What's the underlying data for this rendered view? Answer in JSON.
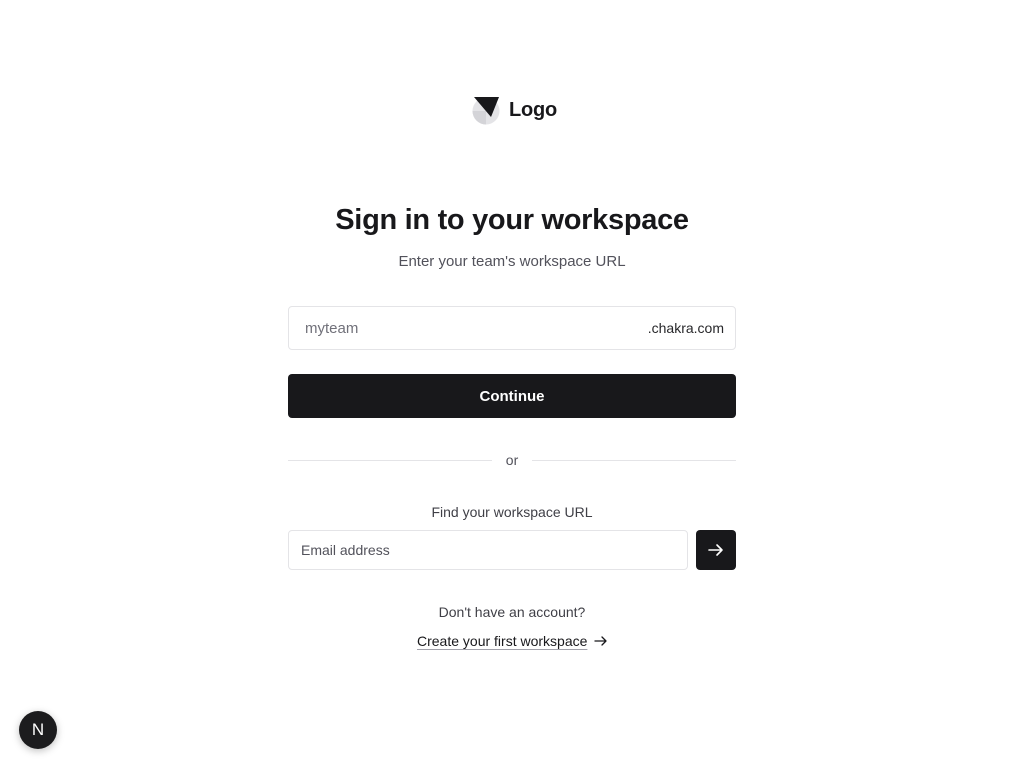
{
  "logo": {
    "text": "Logo",
    "icon": "logo-mark-icon"
  },
  "heading": {
    "title": "Sign in to your workspace",
    "subtitle": "Enter your team's workspace URL"
  },
  "workspace_url": {
    "value": "",
    "placeholder": "myteam",
    "suffix": ".chakra.com"
  },
  "continue_button": {
    "label": "Continue"
  },
  "divider": {
    "text": "or"
  },
  "find_workspace": {
    "label": "Find your workspace URL",
    "email_value": "",
    "email_placeholder": "Email address",
    "submit_icon": "arrow-right-icon"
  },
  "signup": {
    "prompt": "Don't have an account?",
    "link_text": "Create your first workspace",
    "link_icon": "arrow-right-icon"
  },
  "devtools": {
    "badge_letter": "N"
  },
  "colors": {
    "primary": "#18181b",
    "border": "#e4e4e7",
    "muted_text": "#52525b",
    "background": "#ffffff"
  }
}
